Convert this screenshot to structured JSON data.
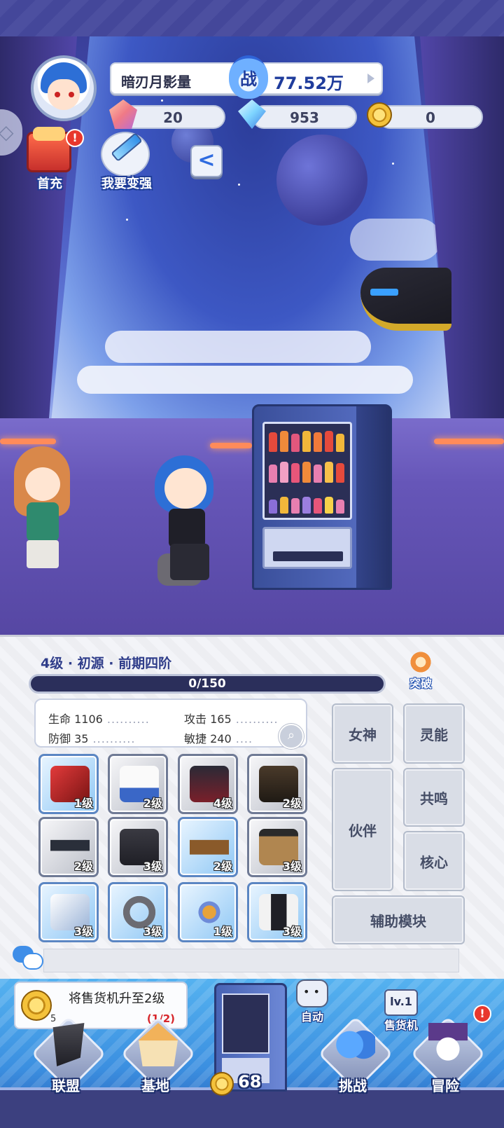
{
  "player": {
    "name": "暗刃月影量",
    "power_icon": "战",
    "power_value": "77.52万"
  },
  "resources": [
    {
      "name": "red-gem",
      "value": "20"
    },
    {
      "name": "blue-diamond",
      "value": "953"
    },
    {
      "name": "gold-coin",
      "value": "0"
    }
  ],
  "hud_buttons": {
    "first_recharge": "首充",
    "first_recharge_alert": "!",
    "get_stronger": "我要变强",
    "back": "<"
  },
  "progress": {
    "level_title": "4级 · 初源 · 前期四阶",
    "xp_text": "0/150",
    "xp_fraction": 0,
    "breakthrough": "突破"
  },
  "stats": {
    "hp_label": "生命",
    "hp": "1106",
    "atk_label": "攻击",
    "atk": "165",
    "def_label": "防御",
    "def": "35",
    "agi_label": "敏捷",
    "agi": "240"
  },
  "equipment": [
    {
      "name": "pistol",
      "level": "1级",
      "rarity": "blue"
    },
    {
      "name": "cap",
      "level": "2级",
      "rarity": "grey"
    },
    {
      "name": "jacket",
      "level": "4级",
      "rarity": "grey"
    },
    {
      "name": "boots",
      "level": "2级",
      "rarity": "grey"
    },
    {
      "name": "glasses",
      "level": "2级",
      "rarity": "grey"
    },
    {
      "name": "glove",
      "level": "3级",
      "rarity": "grey"
    },
    {
      "name": "belt",
      "level": "2级",
      "rarity": "blue"
    },
    {
      "name": "shorts",
      "level": "3级",
      "rarity": "grey"
    },
    {
      "name": "wing",
      "level": "3级",
      "rarity": "blue"
    },
    {
      "name": "ring",
      "level": "3级",
      "rarity": "blue"
    },
    {
      "name": "necklace",
      "level": "1级",
      "rarity": "blue"
    },
    {
      "name": "coat",
      "level": "3级",
      "rarity": "blue"
    }
  ],
  "side_menu": {
    "goddess": "女神",
    "psionic": "灵能",
    "partner": "伙伴",
    "resonance": "共鸣",
    "core": "核心",
    "aux_module": "辅助模块"
  },
  "task": {
    "text": "将售货机升至2级",
    "coin_count": "5",
    "progress": "(1/2)"
  },
  "vending": {
    "price": "68",
    "auto_label": "自动",
    "level_badge": "lv.1",
    "machine_label": "售货机"
  },
  "nav": {
    "alliance": "联盟",
    "base": "基地",
    "challenge": "挑战",
    "adventure": "冒险",
    "adventure_alert": "!"
  }
}
